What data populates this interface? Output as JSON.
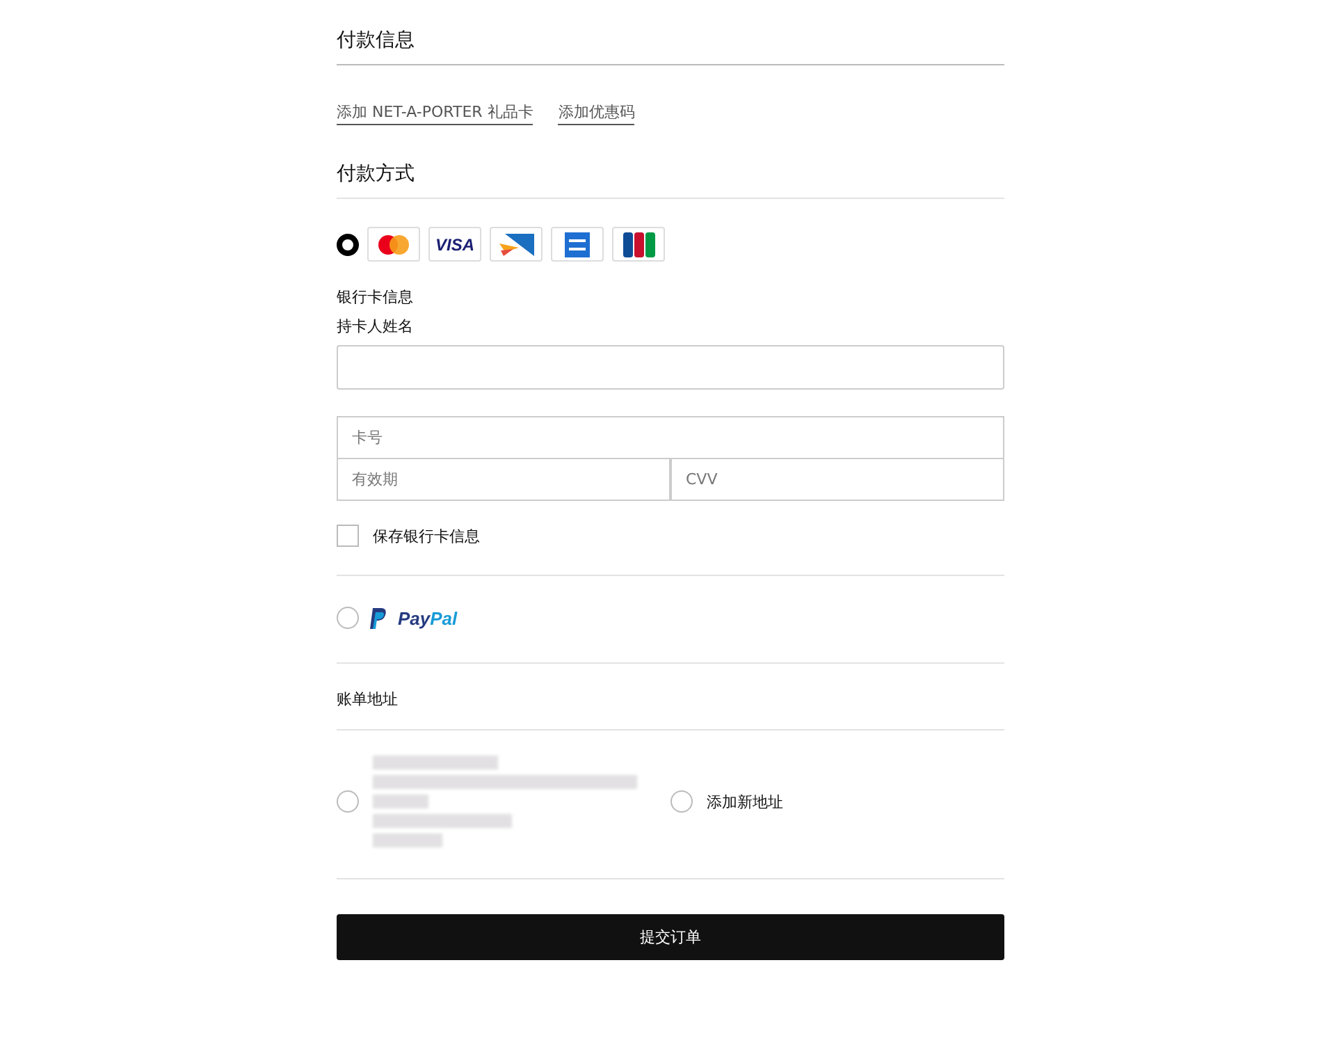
{
  "section_title": "付款信息",
  "links": [
    "添加 NET-A-PORTER 礼品卡",
    "添加优惠码"
  ],
  "payment_title": "付款方式",
  "methods": [
    {
      "kind": "card",
      "selected": true,
      "logos": [
        {
          "kind": "mastercard"
        },
        {
          "kind": "visa",
          "text": "VISA"
        },
        {
          "kind": "delta"
        },
        {
          "kind": "amex"
        },
        {
          "kind": "jcb"
        }
      ]
    },
    {
      "kind": "paypal",
      "selected": false,
      "logo_parts": [
        "Pay",
        "Pal"
      ]
    }
  ],
  "card_form": {
    "heading": "银行卡信息",
    "name_label": "持卡人姓名",
    "number_placeholder": "卡号",
    "expiry_placeholder": "有效期",
    "cvv_placeholder": "CVV",
    "save_label": "保存银行卡信息",
    "save_checked": false
  },
  "billing": {
    "title": "账单地址",
    "options": [
      {
        "kind": "saved",
        "selected": false
      },
      {
        "kind": "new",
        "label": "添加新地址",
        "selected": false
      }
    ]
  },
  "submit": "提交订单"
}
